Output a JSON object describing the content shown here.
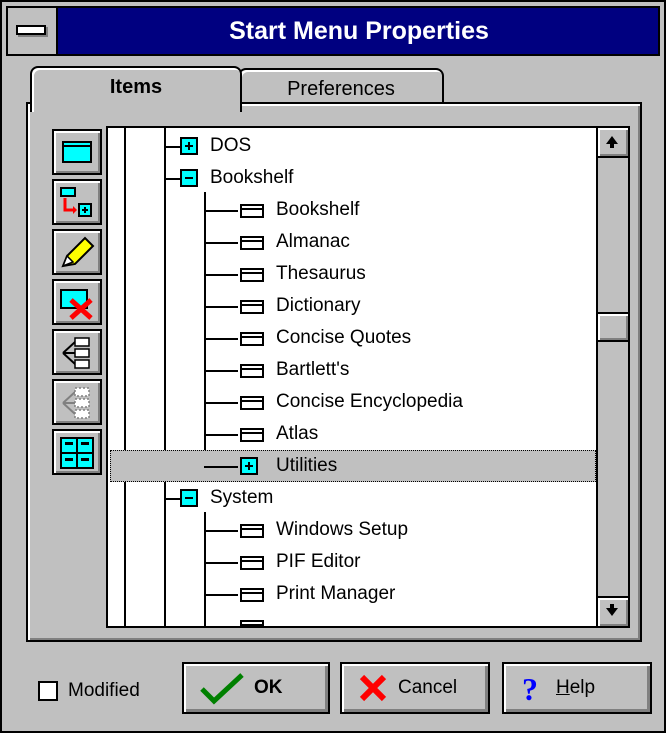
{
  "window": {
    "title": "Start Menu Properties"
  },
  "tabs": [
    {
      "label": "Items",
      "active": true
    },
    {
      "label": "Preferences",
      "active": false
    }
  ],
  "toolbar": [
    {
      "name": "new-item-icon"
    },
    {
      "name": "new-subitem-icon"
    },
    {
      "name": "edit-pencil-icon"
    },
    {
      "name": "delete-icon"
    },
    {
      "name": "expand-tree-icon"
    },
    {
      "name": "collapse-tree-icon"
    },
    {
      "name": "sort-icon"
    }
  ],
  "tree": {
    "items": [
      {
        "label": "DOS",
        "type": "folder",
        "expanded": false,
        "level": 1
      },
      {
        "label": "Bookshelf",
        "type": "folder",
        "expanded": true,
        "level": 1
      },
      {
        "label": "Bookshelf",
        "type": "item",
        "level": 2
      },
      {
        "label": "Almanac",
        "type": "item",
        "level": 2
      },
      {
        "label": "Thesaurus",
        "type": "item",
        "level": 2
      },
      {
        "label": "Dictionary",
        "type": "item",
        "level": 2
      },
      {
        "label": "Concise Quotes",
        "type": "item",
        "level": 2
      },
      {
        "label": "Bartlett's",
        "type": "item",
        "level": 2
      },
      {
        "label": "Concise Encyclopedia",
        "type": "item",
        "level": 2
      },
      {
        "label": "Atlas",
        "type": "item",
        "level": 2
      },
      {
        "label": "Utilities",
        "type": "folder",
        "expanded": false,
        "level": 2,
        "selected": true
      },
      {
        "label": "System",
        "type": "folder",
        "expanded": true,
        "level": 1
      },
      {
        "label": "Windows Setup",
        "type": "item",
        "level": 2
      },
      {
        "label": "PIF Editor",
        "type": "item",
        "level": 2
      },
      {
        "label": "Print Manager",
        "type": "item",
        "level": 2
      }
    ]
  },
  "footer": {
    "modified_label": "Modified",
    "modified_checked": false,
    "ok_label": "OK",
    "cancel_label": "Cancel",
    "help_label": "Help"
  },
  "colors": {
    "titlebar": "#000080",
    "face": "#c0c0c0",
    "accent": "#00ffff"
  }
}
